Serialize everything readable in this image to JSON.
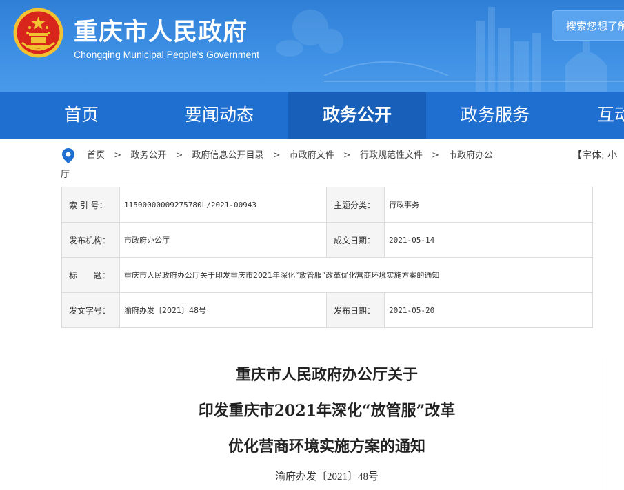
{
  "header": {
    "title": "重庆市人民政府",
    "subtitle": "Chongqing Municipal People’s Government",
    "search_placeholder": "搜索您想了解",
    "colors": {
      "header_bg": "#3d8fe4",
      "nav_bg": "#1f6fd1",
      "nav_active_bg": "#175fb9",
      "emblem_red": "#d9261c",
      "emblem_gold": "#f2c233"
    }
  },
  "nav": {
    "items": [
      {
        "label": "首页"
      },
      {
        "label": "要闻动态"
      },
      {
        "label": "政务公开",
        "active": true
      },
      {
        "label": "政务服务"
      },
      {
        "label": "互动"
      }
    ]
  },
  "breadcrumb": {
    "items": [
      "首页",
      "政务公开",
      "政府信息公开目录",
      "市政府文件",
      "行政规范性文件",
      "市政府办公厅"
    ],
    "separator": ">",
    "font_tool": "【字体: 小"
  },
  "info": {
    "index_label": "索 引 号：",
    "index_value": "11500000009275780L/2021-00943",
    "topic_label": "主题分类：",
    "topic_value": "行政事务",
    "issuer_label": "发布机构：",
    "issuer_value": "市政府办公厅",
    "date_made_label": "成文日期：",
    "date_made_value": "2021-05-14",
    "title_label": "标　　题：",
    "title_value": "重庆市人民政府办公厅关于印发重庆市2021年深化“放管服”改革优化营商环境实施方案的通知",
    "doc_no_label": "发文字号：",
    "doc_no_value": "渝府办发〔2021〕48号",
    "publish_label": "发布日期：",
    "publish_value": "2021-05-20"
  },
  "document": {
    "title_lines": [
      "重庆市人民政府办公厅关于",
      "印发重庆市2021年深化“放管服”改革",
      "优化营商环境实施方案的通知"
    ],
    "number": "渝府办发〔2021〕48号"
  }
}
